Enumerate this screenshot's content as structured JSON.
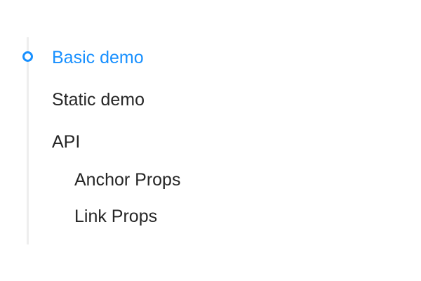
{
  "anchor": {
    "active_color": "#1890ff",
    "text_color": "#262626",
    "links": [
      {
        "label": "Basic demo",
        "active": true
      },
      {
        "label": "Static demo",
        "active": false
      },
      {
        "label": "API",
        "active": false
      },
      {
        "label": "Anchor Props",
        "active": false,
        "nested": true
      },
      {
        "label": "Link Props",
        "active": false,
        "nested": true
      }
    ]
  }
}
